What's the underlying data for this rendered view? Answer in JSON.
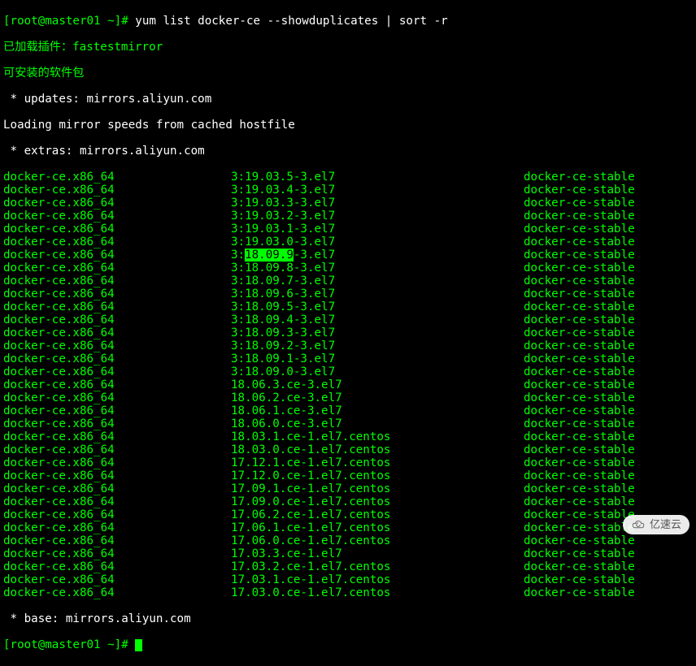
{
  "prompt": {
    "user_host": "[root@master01 ~]#",
    "command": "yum list docker-ce --showduplicates | sort -r"
  },
  "header": {
    "plugins_loaded": "已加载插件：fastestmirror",
    "available_packages": "可安装的软件包",
    "updates_line": " * updates: mirrors.aliyun.com",
    "loading_line": "Loading mirror speeds from cached hostfile",
    "extras_line": " * extras: mirrors.aliyun.com",
    "base_line": " * base: mirrors.aliyun.com"
  },
  "highlight_version": "18.09.9",
  "packages": [
    {
      "name": "docker-ce.x86_64",
      "version": "3:19.03.5-3.el7",
      "repo": "docker-ce-stable"
    },
    {
      "name": "docker-ce.x86_64",
      "version": "3:19.03.4-3.el7",
      "repo": "docker-ce-stable"
    },
    {
      "name": "docker-ce.x86_64",
      "version": "3:19.03.3-3.el7",
      "repo": "docker-ce-stable"
    },
    {
      "name": "docker-ce.x86_64",
      "version": "3:19.03.2-3.el7",
      "repo": "docker-ce-stable"
    },
    {
      "name": "docker-ce.x86_64",
      "version": "3:19.03.1-3.el7",
      "repo": "docker-ce-stable"
    },
    {
      "name": "docker-ce.x86_64",
      "version": "3:19.03.0-3.el7",
      "repo": "docker-ce-stable"
    },
    {
      "name": "docker-ce.x86_64",
      "version_pre": "3:",
      "version_hl": "18.09.9",
      "version_post": "-3.el7",
      "repo": "docker-ce-stable",
      "highlighted": true
    },
    {
      "name": "docker-ce.x86_64",
      "version": "3:18.09.8-3.el7",
      "repo": "docker-ce-stable"
    },
    {
      "name": "docker-ce.x86_64",
      "version": "3:18.09.7-3.el7",
      "repo": "docker-ce-stable"
    },
    {
      "name": "docker-ce.x86_64",
      "version": "3:18.09.6-3.el7",
      "repo": "docker-ce-stable"
    },
    {
      "name": "docker-ce.x86_64",
      "version": "3:18.09.5-3.el7",
      "repo": "docker-ce-stable"
    },
    {
      "name": "docker-ce.x86_64",
      "version": "3:18.09.4-3.el7",
      "repo": "docker-ce-stable"
    },
    {
      "name": "docker-ce.x86_64",
      "version": "3:18.09.3-3.el7",
      "repo": "docker-ce-stable"
    },
    {
      "name": "docker-ce.x86_64",
      "version": "3:18.09.2-3.el7",
      "repo": "docker-ce-stable"
    },
    {
      "name": "docker-ce.x86_64",
      "version": "3:18.09.1-3.el7",
      "repo": "docker-ce-stable"
    },
    {
      "name": "docker-ce.x86_64",
      "version": "3:18.09.0-3.el7",
      "repo": "docker-ce-stable"
    },
    {
      "name": "docker-ce.x86_64",
      "version": "18.06.3.ce-3.el7",
      "repo": "docker-ce-stable"
    },
    {
      "name": "docker-ce.x86_64",
      "version": "18.06.2.ce-3.el7",
      "repo": "docker-ce-stable"
    },
    {
      "name": "docker-ce.x86_64",
      "version": "18.06.1.ce-3.el7",
      "repo": "docker-ce-stable"
    },
    {
      "name": "docker-ce.x86_64",
      "version": "18.06.0.ce-3.el7",
      "repo": "docker-ce-stable"
    },
    {
      "name": "docker-ce.x86_64",
      "version": "18.03.1.ce-1.el7.centos",
      "repo": "docker-ce-stable"
    },
    {
      "name": "docker-ce.x86_64",
      "version": "18.03.0.ce-1.el7.centos",
      "repo": "docker-ce-stable"
    },
    {
      "name": "docker-ce.x86_64",
      "version": "17.12.1.ce-1.el7.centos",
      "repo": "docker-ce-stable"
    },
    {
      "name": "docker-ce.x86_64",
      "version": "17.12.0.ce-1.el7.centos",
      "repo": "docker-ce-stable"
    },
    {
      "name": "docker-ce.x86_64",
      "version": "17.09.1.ce-1.el7.centos",
      "repo": "docker-ce-stable"
    },
    {
      "name": "docker-ce.x86_64",
      "version": "17.09.0.ce-1.el7.centos",
      "repo": "docker-ce-stable"
    },
    {
      "name": "docker-ce.x86_64",
      "version": "17.06.2.ce-1.el7.centos",
      "repo": "docker-ce-stable"
    },
    {
      "name": "docker-ce.x86_64",
      "version": "17.06.1.ce-1.el7.centos",
      "repo": "docker-ce-stable"
    },
    {
      "name": "docker-ce.x86_64",
      "version": "17.06.0.ce-1.el7.centos",
      "repo": "docker-ce-stable"
    },
    {
      "name": "docker-ce.x86_64",
      "version": "17.03.3.ce-1.el7",
      "repo": "docker-ce-stable"
    },
    {
      "name": "docker-ce.x86_64",
      "version": "17.03.2.ce-1.el7.centos",
      "repo": "docker-ce-stable"
    },
    {
      "name": "docker-ce.x86_64",
      "version": "17.03.1.ce-1.el7.centos",
      "repo": "docker-ce-stable"
    },
    {
      "name": "docker-ce.x86_64",
      "version": "17.03.0.ce-1.el7.centos",
      "repo": "docker-ce-stable"
    }
  ],
  "prompt2": {
    "user_host": "[root@master01 ~]#"
  },
  "watermark": "亿速云"
}
